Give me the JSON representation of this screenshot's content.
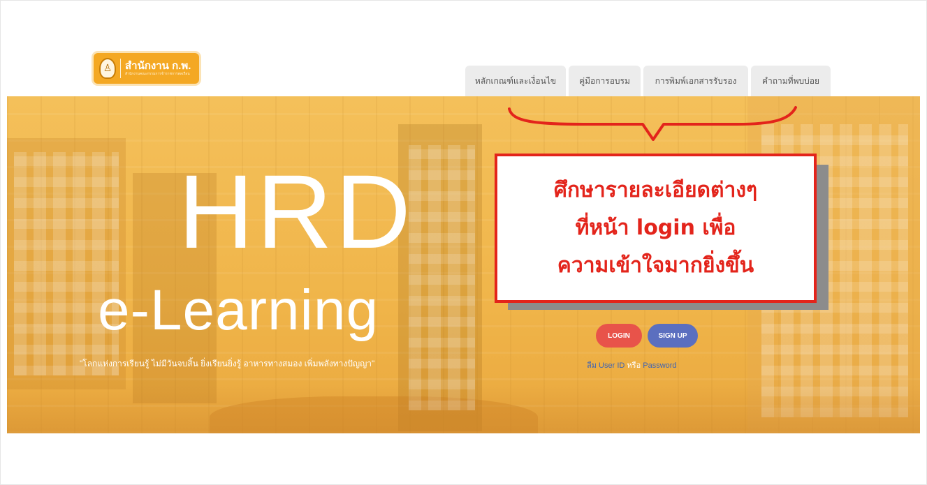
{
  "header": {
    "logo_title": "สำนักงาน ก.พ.",
    "logo_subtitle": "สำนักงานคณะกรรมการข้าราชการพลเรือน",
    "logo_icon": "emblem-icon"
  },
  "nav": {
    "tabs": [
      {
        "label": "หลักเกณฑ์และเงื่อนไข"
      },
      {
        "label": "คู่มือการอบรม"
      },
      {
        "label": "การพิมพ์เอกสารรับรอง"
      },
      {
        "label": "คำถามที่พบบ่อย"
      }
    ]
  },
  "hero": {
    "title": "HRD",
    "subtitle": "e-Learning",
    "slogan": "\"โลกแห่งการเรียนรู้ ไม่มีวันจบสิ้น ยิ่งเรียนยิ่งรู้ อาหารทางสมอง เพิ่มพลังทางปัญญา\"",
    "login_label": "LOGIN",
    "signup_label": "SIGN UP",
    "forgot_user": "ลืม User ID",
    "forgot_or": "หรือ",
    "forgot_password": "Password"
  },
  "annotation": {
    "line1": "ศึกษารายละเอียดต่างๆ",
    "line2": "ที่หน้า login เพื่อ",
    "line3": "ความเข้าใจมากยิ่งขึ้น",
    "color": "#e3241b"
  },
  "colors": {
    "hero_bg": "#f2bd52",
    "login_btn": "#e8534a",
    "signup_btn": "#5b6fbf",
    "tab_bg": "#ececec",
    "logo_bg": "#f4a823"
  }
}
